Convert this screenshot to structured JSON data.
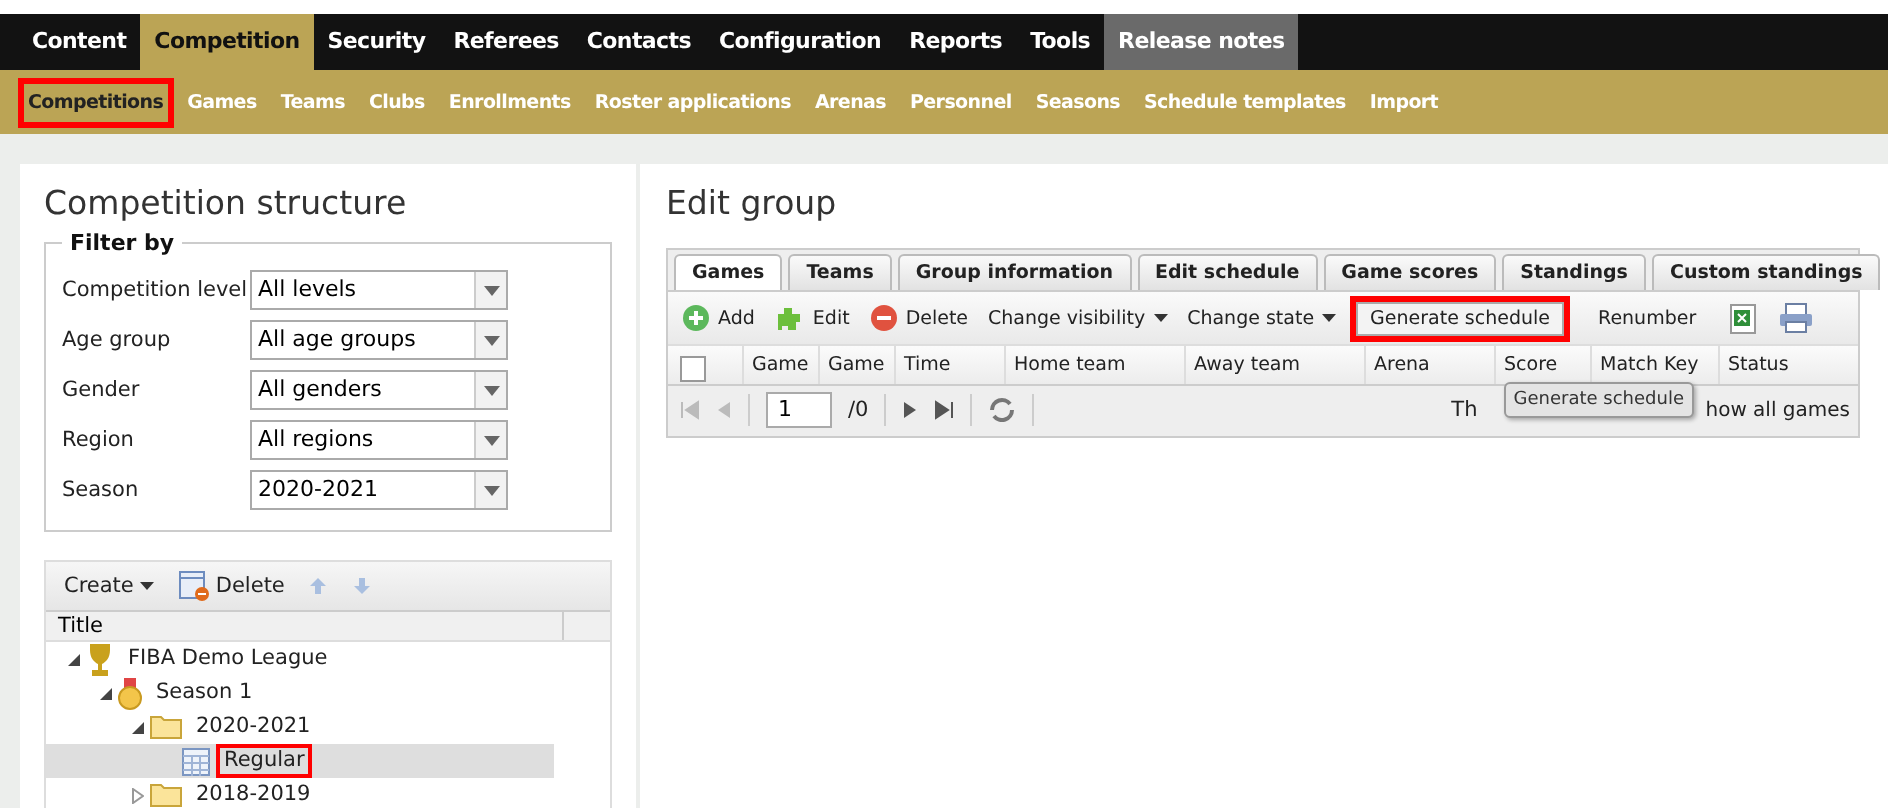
{
  "main_nav": [
    {
      "label": "Content",
      "selected": false,
      "kind": "normal"
    },
    {
      "label": "Competition",
      "selected": true,
      "kind": "normal"
    },
    {
      "label": "Security",
      "selected": false,
      "kind": "normal"
    },
    {
      "label": "Referees",
      "selected": false,
      "kind": "normal"
    },
    {
      "label": "Contacts",
      "selected": false,
      "kind": "normal"
    },
    {
      "label": "Configuration",
      "selected": false,
      "kind": "normal"
    },
    {
      "label": "Reports",
      "selected": false,
      "kind": "normal"
    },
    {
      "label": "Tools",
      "selected": false,
      "kind": "normal"
    },
    {
      "label": "Release notes",
      "selected": false,
      "kind": "grey"
    }
  ],
  "sub_nav": [
    {
      "label": "Competitions",
      "highlighted": true
    },
    {
      "label": "Games",
      "highlighted": false
    },
    {
      "label": "Teams",
      "highlighted": false
    },
    {
      "label": "Clubs",
      "highlighted": false
    },
    {
      "label": "Enrollments",
      "highlighted": false
    },
    {
      "label": "Roster applications",
      "highlighted": false
    },
    {
      "label": "Arenas",
      "highlighted": false
    },
    {
      "label": "Personnel",
      "highlighted": false
    },
    {
      "label": "Seasons",
      "highlighted": false
    },
    {
      "label": "Schedule templates",
      "highlighted": false
    },
    {
      "label": "Import",
      "highlighted": false
    }
  ],
  "left": {
    "title": "Competition structure",
    "filter_legend": "Filter by",
    "filters": [
      {
        "label": "Competition level",
        "value": "All levels"
      },
      {
        "label": "Age group",
        "value": "All age groups"
      },
      {
        "label": "Gender",
        "value": "All genders"
      },
      {
        "label": "Region",
        "value": "All regions"
      },
      {
        "label": "Season",
        "value": "2020-2021"
      }
    ],
    "tree_toolbar": {
      "create": "Create",
      "delete": "Delete"
    },
    "tree_column": "Title",
    "tree": [
      {
        "label": "FIBA Demo League",
        "kind": "trophy",
        "expanded": true,
        "selected": false,
        "highlighted": false,
        "children": [
          {
            "label": "Season 1",
            "kind": "medal",
            "expanded": true,
            "selected": false,
            "highlighted": false,
            "children": [
              {
                "label": "2020-2021",
                "kind": "folder",
                "expanded": true,
                "selected": false,
                "highlighted": false,
                "children": [
                  {
                    "label": "Regular",
                    "kind": "group",
                    "selected": true,
                    "highlighted": true
                  }
                ]
              },
              {
                "label": "2018-2019",
                "kind": "folder",
                "expanded": false,
                "selected": false,
                "highlighted": false
              }
            ]
          }
        ]
      }
    ]
  },
  "right": {
    "title": "Edit group",
    "tabs": [
      {
        "label": "Games",
        "selected": true
      },
      {
        "label": "Teams",
        "selected": false
      },
      {
        "label": "Group information",
        "selected": false
      },
      {
        "label": "Edit schedule",
        "selected": false
      },
      {
        "label": "Game scores",
        "selected": false
      },
      {
        "label": "Standings",
        "selected": false
      },
      {
        "label": "Custom standings",
        "selected": false
      }
    ],
    "toolbar": [
      {
        "kind": "add",
        "label": "Add"
      },
      {
        "kind": "edit",
        "label": "Edit"
      },
      {
        "kind": "delete",
        "label": "Delete"
      },
      {
        "kind": "menu",
        "label": "Change visibility"
      },
      {
        "kind": "menu",
        "label": "Change state"
      },
      {
        "kind": "button",
        "label": "Generate schedule",
        "highlighted": true
      },
      {
        "kind": "button",
        "label": "Renumber",
        "highlighted": false
      },
      {
        "kind": "excel"
      },
      {
        "kind": "print"
      }
    ],
    "select_all_checked": false,
    "columns": [
      "Game",
      "Game",
      "Time",
      "Home team",
      "Away team",
      "Arena",
      "Score",
      "Match Key",
      "Status"
    ],
    "pager": {
      "page": "1",
      "total": "/0",
      "note": "Th",
      "show_all": "how all games"
    },
    "tooltip": "Generate schedule"
  }
}
